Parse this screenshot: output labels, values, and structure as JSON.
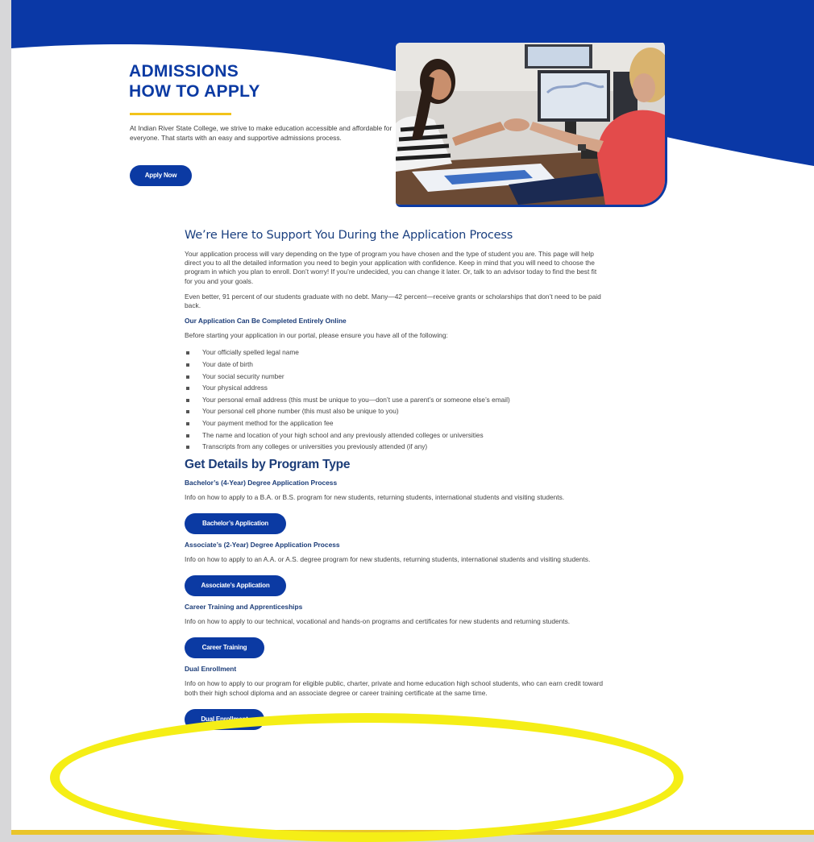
{
  "hero": {
    "title_line1": "ADMISSIONS ",
    "title_line2": "HOW TO APPLY",
    "intro": "At Indian River State College, we strive to make education accessible and affordable for everyone. That starts with an easy and supportive admissions process.",
    "apply_button": "Apply Now",
    "colors": {
      "brand_blue": "#0b3aa3",
      "gold": "#f2c31a"
    }
  },
  "support": {
    "heading": "We’re Here to Support You During the Application Process",
    "para1": "Your application process will vary depending on the type of program you have chosen and the type of student you are. This page will help direct you to all the detailed information you need to begin your application with confidence. Keep in mind that you will need to choose the program in which you plan to enroll. Don’t worry! If you’re undecided, you can change it later. Or, talk to an advisor today to find the best fit for you and your goals.",
    "para2": "Even better, 91 percent of our students graduate with no debt. Many—42 percent—receive grants or scholarships that don’t need to be paid back.",
    "online_heading": "Our Application Can Be Completed Entirely Online",
    "online_intro": "Before starting your application in our portal, please ensure you have all of the following:",
    "checklist": [
      "Your officially spelled legal name",
      "Your date of birth",
      "Your social security number",
      "Your physical address",
      "Your personal email address (this must be unique to you—don’t use a parent’s or someone else’s email)",
      "Your personal cell phone number (this must also be unique to you)",
      "Your payment method for the application fee",
      "The name and location of your high school and any previously attended colleges or universities",
      "Transcripts from any colleges or universities you previously attended (if any)"
    ]
  },
  "programs": {
    "heading": "Get Details by Program Type",
    "items": [
      {
        "title": "Bachelor’s (4-Year) Degree Application Process",
        "desc": "Info on how to apply to a B.A. or B.S. program for new students, returning students, international students and visiting students.",
        "button": "Bachelor’s Application"
      },
      {
        "title": "Associate’s (2-Year) Degree Application Process",
        "desc": "Info on how to apply to an A.A. or A.S. degree program for new students, returning students, international students and visiting students.",
        "button": "Associate’s Application"
      },
      {
        "title": "Career Training and Apprenticeships",
        "desc": "Info on how to apply to our technical, vocational and hands-on programs and certificates for new students and returning students.",
        "button": "Career Training"
      },
      {
        "title": "Dual Enrollment",
        "desc": "Info on how to apply to our program for eligible public, charter, private and home education high school students, who can earn credit toward both their high school diploma and an associate degree or career training certificate at the same time.",
        "button": "Dual Enrollment"
      }
    ]
  },
  "annotation": {
    "color": "#f5ee16"
  }
}
